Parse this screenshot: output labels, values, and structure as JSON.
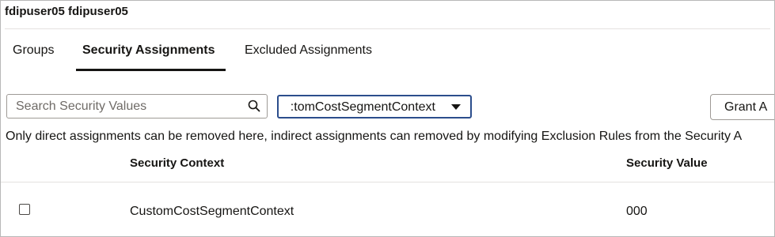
{
  "user": {
    "title": "fdipuser05 fdipuser05"
  },
  "tabs": [
    {
      "label": "Groups",
      "active": false
    },
    {
      "label": "Security Assignments",
      "active": true
    },
    {
      "label": "Excluded Assignments",
      "active": false
    }
  ],
  "toolbar": {
    "search_placeholder": "Search Security Values",
    "search_value": "",
    "search_icon": "search-icon",
    "context_select_value": "CustomCostSegmentContext",
    "context_select_visible_text": ":tomCostSegmentContext",
    "grant_button_label": "Grant A"
  },
  "info_message": "Only direct assignments can be removed here, indirect assignments can removed by modifying Exclusion Rules from the Security A",
  "table": {
    "columns": [
      "Security Context",
      "Security Value"
    ],
    "rows": [
      {
        "checked": false,
        "security_context": "CustomCostSegmentContext",
        "security_value": "000"
      }
    ]
  },
  "colors": {
    "select_border": "#2b4d8c",
    "active_tab_underline": "#161513",
    "text": "#161513"
  }
}
